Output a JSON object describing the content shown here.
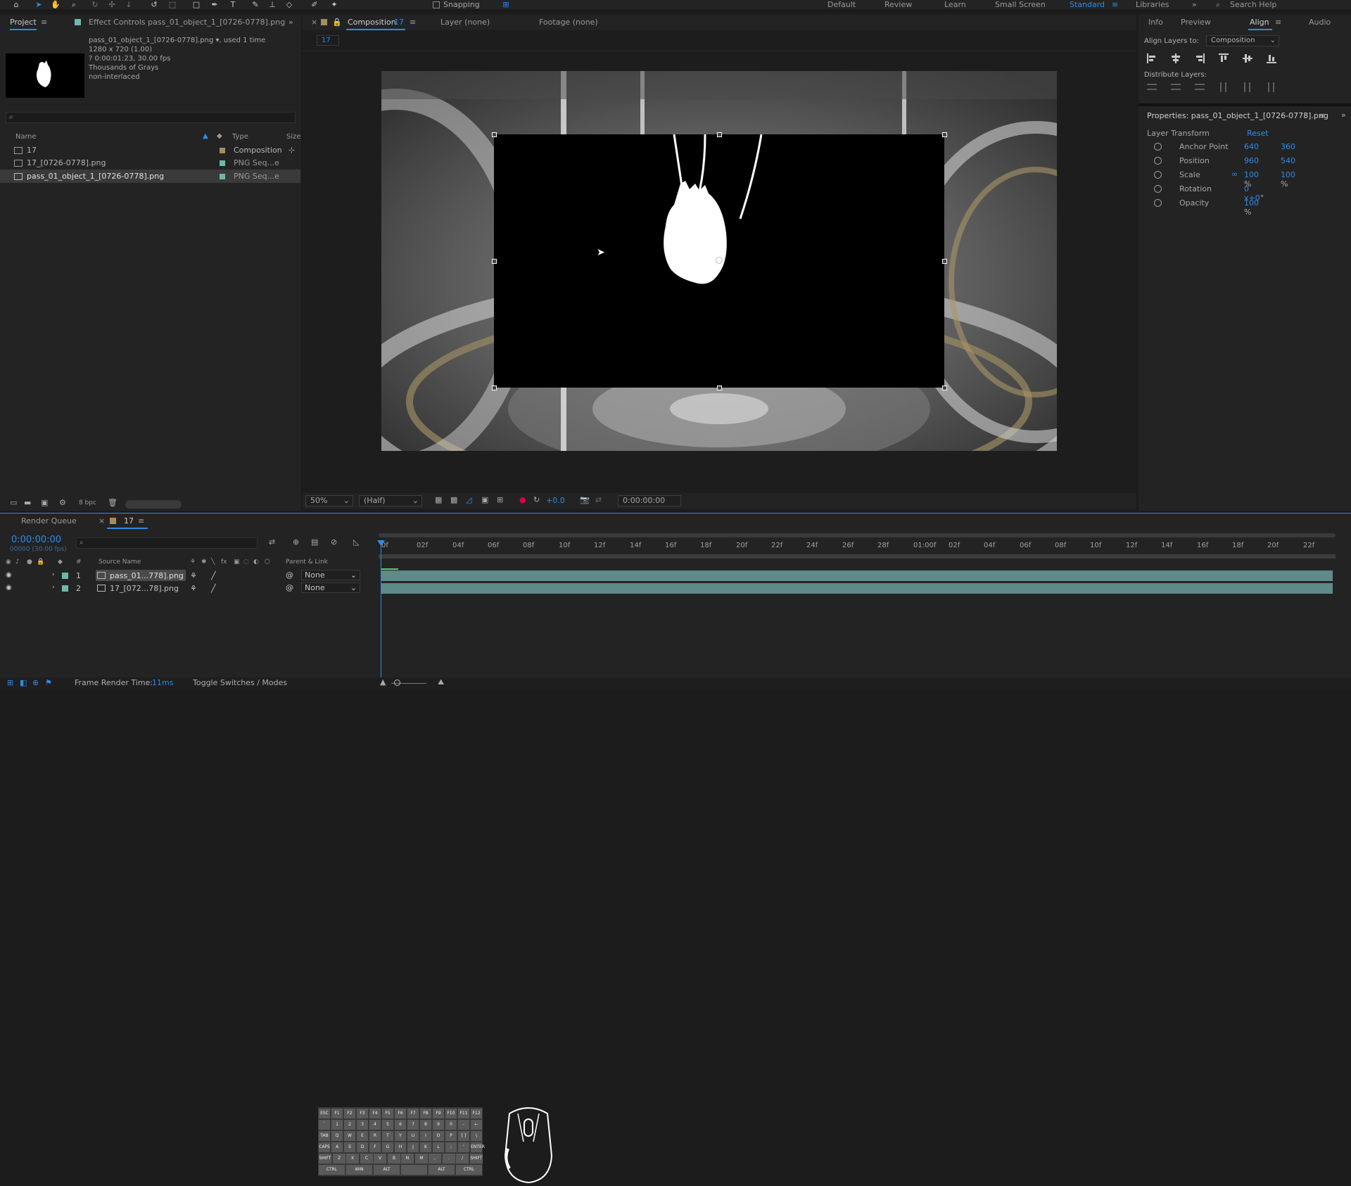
{
  "toolbar": {
    "snapping_label": "Snapping",
    "workspaces": [
      "Default",
      "Review",
      "Learn",
      "Small Screen",
      "Standard",
      "Libraries"
    ],
    "active_workspace": "Standard",
    "search_placeholder": "Search Help"
  },
  "project_panel": {
    "tab_project": "Project",
    "tab_effect_controls": "Effect Controls pass_01_object_1_[0726-0778].png",
    "selected_item": {
      "name": "pass_01_object_1_[0726-0778].png",
      "used": ", used 1 time",
      "dimensions": "1280 x 720 (1.00)",
      "duration": "? 0:00:01:23, 30.00 fps",
      "colors": "Thousands of Grays",
      "interlace": "non-interlaced"
    },
    "columns": {
      "name": "Name",
      "type": "Type",
      "size": "Size"
    },
    "items": [
      {
        "name": "17",
        "type": "Composition",
        "color": "#a48d5e"
      },
      {
        "name": "17_[0726-0778].png",
        "type": "PNG Seq...e",
        "color": "#6fb7ac"
      },
      {
        "name": "pass_01_object_1_[0726-0778].png",
        "type": "PNG Seq...e",
        "color": "#6fb7ac"
      }
    ],
    "bpc": "8 bpc"
  },
  "composition_panel": {
    "tab_composition": "Composition",
    "comp_name": "17",
    "tab_layer": "Layer (none)",
    "tab_footage": "Footage (none)",
    "breadcrumb": "17",
    "zoom": "50%",
    "resolution": "(Half)",
    "exposure": "+0.0",
    "timecode": "0:00:00:00"
  },
  "right_panel": {
    "tabs": [
      "Info",
      "Preview",
      "Align",
      "Audio"
    ],
    "active_tab": "Align",
    "align_layers_to_label": "Align Layers to:",
    "align_target": "Composition",
    "distribute_label": "Distribute Layers:",
    "properties_title": "Properties: pass_01_object_1_[0726-0778].png",
    "layer_transform": "Layer Transform",
    "reset": "Reset",
    "properties": [
      {
        "label": "Anchor Point",
        "v1": "640",
        "v2": "360",
        "unit": ""
      },
      {
        "label": "Position",
        "v1": "960",
        "v2": "540",
        "unit": ""
      },
      {
        "label": "Scale",
        "v1": "100",
        "v2": "100",
        "unit": "%"
      },
      {
        "label": "Rotation",
        "v1": "0",
        "v2": "x+0",
        "unit": "°"
      },
      {
        "label": "Opacity",
        "v1": "100",
        "v2": "",
        "unit": "%"
      }
    ]
  },
  "timeline": {
    "tab_render_queue": "Render Queue",
    "tab_comp": "17",
    "current_time": "0:00:00:00",
    "frame_info": "00000 (30.00 fps)",
    "col_source_name": "Source Name",
    "col_parent": "Parent & Link",
    "layers": [
      {
        "num": "1",
        "name": "pass_01...778].png",
        "parent": "None"
      },
      {
        "num": "2",
        "name": "17_[072...78].png",
        "parent": "None"
      }
    ],
    "ruler": [
      "0f",
      "02f",
      "04f",
      "06f",
      "08f",
      "10f",
      "12f",
      "14f",
      "16f",
      "18f",
      "20f",
      "22f",
      "24f",
      "26f",
      "28f",
      "01:00f",
      "02f",
      "04f",
      "06f",
      "08f",
      "10f",
      "12f",
      "14f",
      "16f",
      "18f",
      "20f",
      "22f"
    ]
  },
  "status": {
    "frame_render_label": "Frame Render Time:",
    "frame_render_value": "11ms",
    "toggle_label": "Toggle Switches / Modes"
  },
  "overlay_keyboard": {
    "rows": [
      [
        "ESC",
        "F1",
        "F2",
        "F3",
        "F4",
        "F5",
        "F6",
        "F7",
        "F8",
        "F9",
        "F10",
        "F11",
        "F12"
      ],
      [
        "`",
        "1",
        "2",
        "3",
        "4",
        "5",
        "6",
        "7",
        "8",
        "9",
        "0",
        "-",
        "←"
      ],
      [
        "TAB",
        "Q",
        "W",
        "E",
        "R",
        "T",
        "Y",
        "U",
        "I",
        "O",
        "P",
        "[ ]",
        "\\"
      ],
      [
        "CAPS",
        "A",
        "S",
        "D",
        "F",
        "G",
        "H",
        "J",
        "K",
        "L",
        ";",
        "'",
        "ENTER"
      ],
      [
        "SHIFT",
        "Z",
        "X",
        "C",
        "V",
        "B",
        "N",
        "M",
        ",",
        ".",
        "/",
        "SHIFT"
      ],
      [
        "CTRL",
        "WIN",
        "ALT",
        "",
        "ALT",
        "CTRL"
      ]
    ]
  }
}
